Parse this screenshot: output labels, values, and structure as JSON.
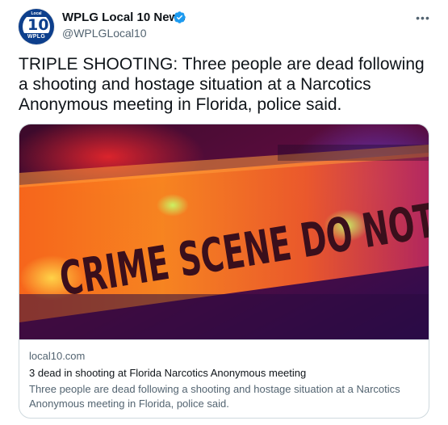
{
  "author": {
    "display_name": "WPLG Local 10 News",
    "handle": "@WPLGLocal10",
    "avatar_text_top": "Local",
    "avatar_number": "10",
    "avatar_text_bottom": "WPLG",
    "verified": true,
    "verified_icon": "verified-badge-icon",
    "accent_color": "#1d9bf0"
  },
  "more_icon": "ellipsis-icon",
  "tweet": {
    "text": "TRIPLE SHOOTING: Three people are dead following a shooting and hostage situation at a Narcotics Anonymous meeting in Florida, police said."
  },
  "link_card": {
    "image_text": "CRIME SCENE DO NOT",
    "domain": "local10.com",
    "title": "3 dead in shooting at Florida Narcotics Anonymous meeting",
    "description": "Three people are dead following a shooting and hostage situation at a Narcotics Anonymous meeting in Florida, police said."
  }
}
